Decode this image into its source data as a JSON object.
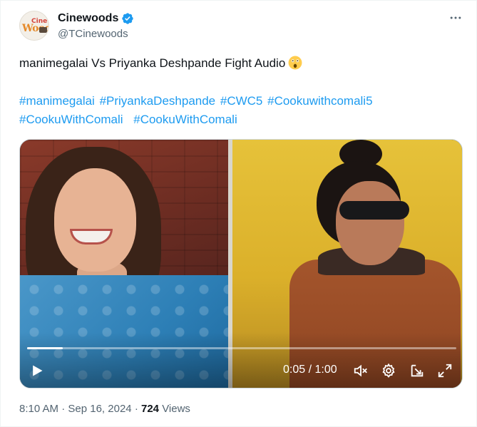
{
  "author": {
    "display_name": "Cinewoods",
    "handle": "@TCinewoods",
    "avatar_text_top": "Cine",
    "avatar_text_main": "Wood",
    "verified": true
  },
  "tweet": {
    "text": "manimegalai Vs Priyanka Deshpande Fight Audio",
    "emoji": "astonished-face",
    "hashtags": [
      "#manimegalai",
      "#PriyankaDeshpande",
      "#CWC5",
      "#Cookuwithcomali5",
      "#CookuWithComali",
      "#CookuWithComali"
    ]
  },
  "video": {
    "current_time": "0:05",
    "duration": "1:00",
    "time_display": "0:05 / 1:00",
    "progress": 0.083
  },
  "footer": {
    "time": "8:10 AM",
    "separator": "·",
    "date": "Sep 16, 2024",
    "views_count": "724",
    "views_label": "Views"
  },
  "colors": {
    "link": "#1d9bf0",
    "secondary_text": "#536471",
    "primary_text": "#0f1419",
    "verified": "#1d9bf0"
  },
  "icons": [
    "verified-badge-icon",
    "more-icon",
    "play-icon",
    "mute-icon",
    "settings-icon",
    "dock-icon",
    "fullscreen-icon"
  ]
}
